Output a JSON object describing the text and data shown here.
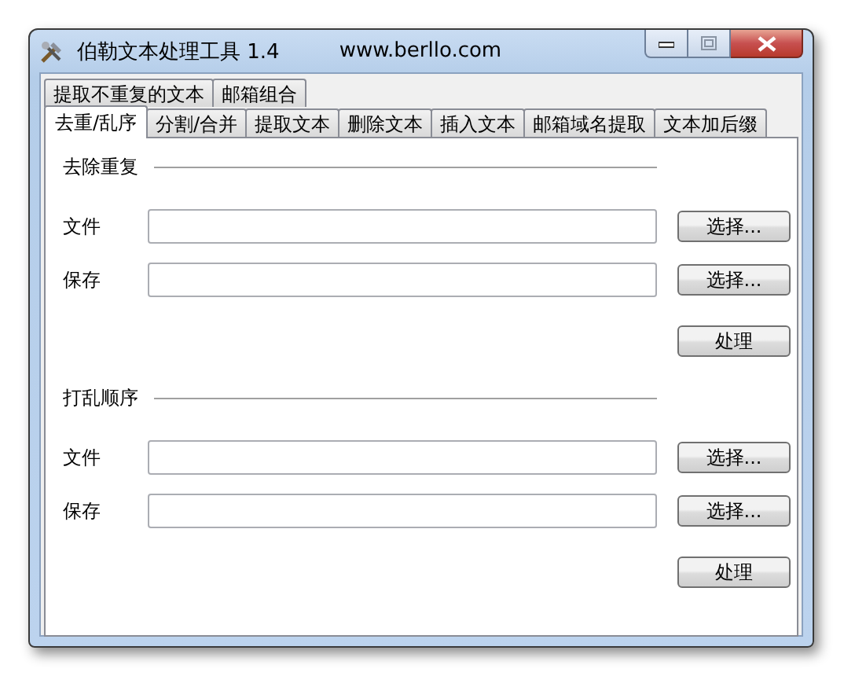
{
  "window": {
    "title": "伯勒文本处理工具 1.4",
    "website": "www.berllo.com"
  },
  "tab_rows": [
    {
      "tabs": [
        {
          "label": "提取不重复的文本",
          "selected": false
        },
        {
          "label": "邮箱组合",
          "selected": false
        }
      ]
    },
    {
      "tabs": [
        {
          "label": "去重/乱序",
          "selected": true
        },
        {
          "label": "分割/合并",
          "selected": false
        },
        {
          "label": "提取文本",
          "selected": false
        },
        {
          "label": "删除文本",
          "selected": false
        },
        {
          "label": "插入文本",
          "selected": false
        },
        {
          "label": "邮箱域名提取",
          "selected": false
        },
        {
          "label": "文本加后缀",
          "selected": false
        }
      ]
    }
  ],
  "sections": [
    {
      "title": "去除重复",
      "rows": [
        {
          "label": "文件",
          "button": "选择..."
        },
        {
          "label": "保存",
          "button": "选择..."
        }
      ],
      "action": "处理"
    },
    {
      "title": "打乱顺序",
      "rows": [
        {
          "label": "文件",
          "button": "选择..."
        },
        {
          "label": "保存",
          "button": "选择..."
        }
      ],
      "action": "处理"
    }
  ]
}
